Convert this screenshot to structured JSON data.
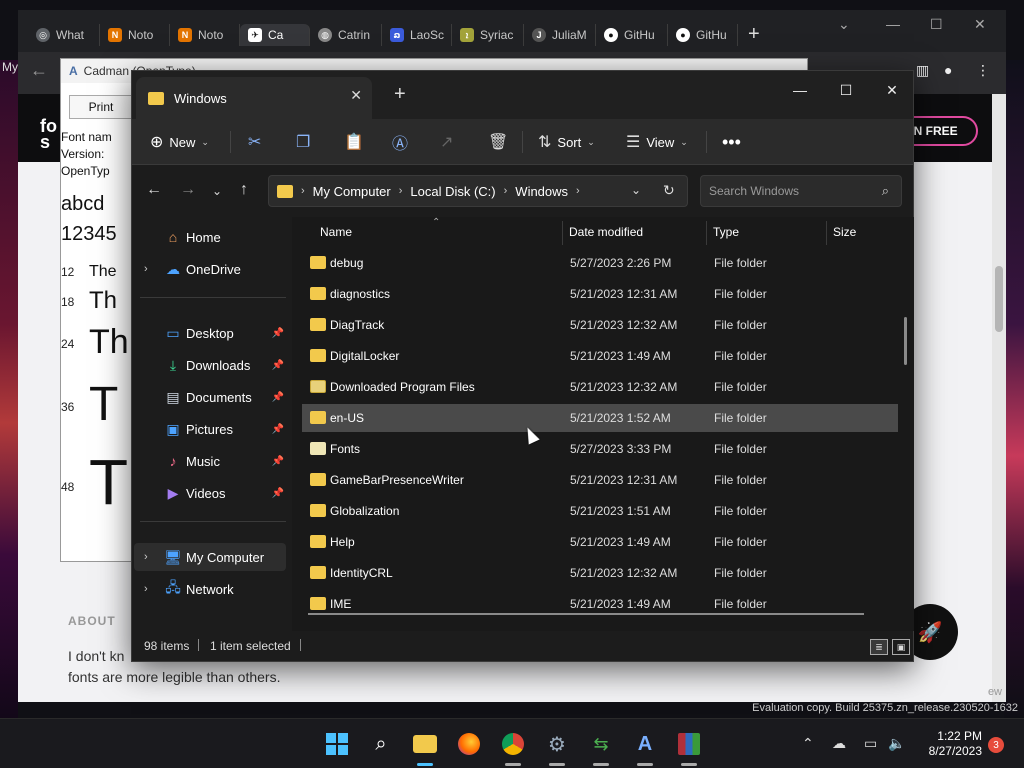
{
  "browser": {
    "tabs": [
      {
        "label": "What",
        "favicon": "chrome-icon",
        "color": "#5f6368"
      },
      {
        "label": "Noto",
        "favicon": "noto-icon",
        "color": "#e37400"
      },
      {
        "label": "Noto",
        "favicon": "noto-icon",
        "color": "#e37400"
      },
      {
        "label": "Ca",
        "favicon": "site-icon",
        "color": "#ffffff"
      },
      {
        "label": "Catrin",
        "favicon": "globe-icon",
        "color": "#888888"
      },
      {
        "label": "LaoSc",
        "favicon": "lao-icon",
        "color": "#3b5bdb"
      },
      {
        "label": "Syriac",
        "favicon": "syriac-icon",
        "color": "#a3a33a"
      },
      {
        "label": "JuliaM",
        "favicon": "julia-icon",
        "color": "#555555"
      },
      {
        "label": "GitHu",
        "favicon": "github-icon",
        "color": "#ffffff"
      },
      {
        "label": "GitHu",
        "favicon": "github-icon",
        "color": "#ffffff"
      }
    ],
    "sidebar_fragment": "My",
    "site_logo": "fo\ns",
    "signup_label": "IN FREE",
    "about_title": "ABOUT",
    "about_text": "I don't kn\nfonts are more legible than others.",
    "eval_text": "Evaluation copy. Build 25375.zn_release.230520-1632",
    "right_fragment": "ew"
  },
  "font_viewer": {
    "title": "Cadman (OpenType)",
    "print_label": "Print",
    "info_lines": [
      "Font nam",
      "Version:",
      "OpenTyp"
    ],
    "alphabet": [
      "abcd",
      "12345"
    ],
    "samples": [
      {
        "size": "12",
        "text": "The"
      },
      {
        "size": "18",
        "text": "Th"
      },
      {
        "size": "24",
        "text": "Th"
      },
      {
        "size": "36",
        "text": "T"
      },
      {
        "size": "48",
        "text": "T"
      }
    ]
  },
  "explorer": {
    "tab_title": "Windows",
    "new_label": "New",
    "sort_label": "Sort",
    "view_label": "View",
    "breadcrumb": [
      "My Computer",
      "Local Disk (C:)",
      "Windows"
    ],
    "search_placeholder": "Search Windows",
    "nav": {
      "home": "Home",
      "onedrive": "OneDrive",
      "desktop": "Desktop",
      "downloads": "Downloads",
      "documents": "Documents",
      "pictures": "Pictures",
      "music": "Music",
      "videos": "Videos",
      "my_computer": "My Computer",
      "network": "Network"
    },
    "columns": {
      "name": "Name",
      "date": "Date modified",
      "type": "Type",
      "size": "Size"
    },
    "rows": [
      {
        "name": "debug",
        "date": "5/27/2023 2:26 PM",
        "type": "File folder"
      },
      {
        "name": "diagnostics",
        "date": "5/21/2023 12:31 AM",
        "type": "File folder"
      },
      {
        "name": "DiagTrack",
        "date": "5/21/2023 12:32 AM",
        "type": "File folder"
      },
      {
        "name": "DigitalLocker",
        "date": "5/21/2023 1:49 AM",
        "type": "File folder"
      },
      {
        "name": "Downloaded Program Files",
        "date": "5/21/2023 12:32 AM",
        "type": "File folder"
      },
      {
        "name": "en-US",
        "date": "5/21/2023 1:52 AM",
        "type": "File folder"
      },
      {
        "name": "Fonts",
        "date": "5/27/2023 3:33 PM",
        "type": "File folder"
      },
      {
        "name": "GameBarPresenceWriter",
        "date": "5/21/2023 12:31 AM",
        "type": "File folder"
      },
      {
        "name": "Globalization",
        "date": "5/21/2023 1:51 AM",
        "type": "File folder"
      },
      {
        "name": "Help",
        "date": "5/21/2023 1:49 AM",
        "type": "File folder"
      },
      {
        "name": "IdentityCRL",
        "date": "5/21/2023 12:32 AM",
        "type": "File folder"
      },
      {
        "name": "IME",
        "date": "5/21/2023 1:49 AM",
        "type": "File folder"
      }
    ],
    "status_items": "98 items",
    "status_selected": "1 item selected"
  },
  "taskbar": {
    "time": "1:22 PM",
    "date": "8/27/2023",
    "notifications": "3",
    "accent": "#0078d4"
  }
}
